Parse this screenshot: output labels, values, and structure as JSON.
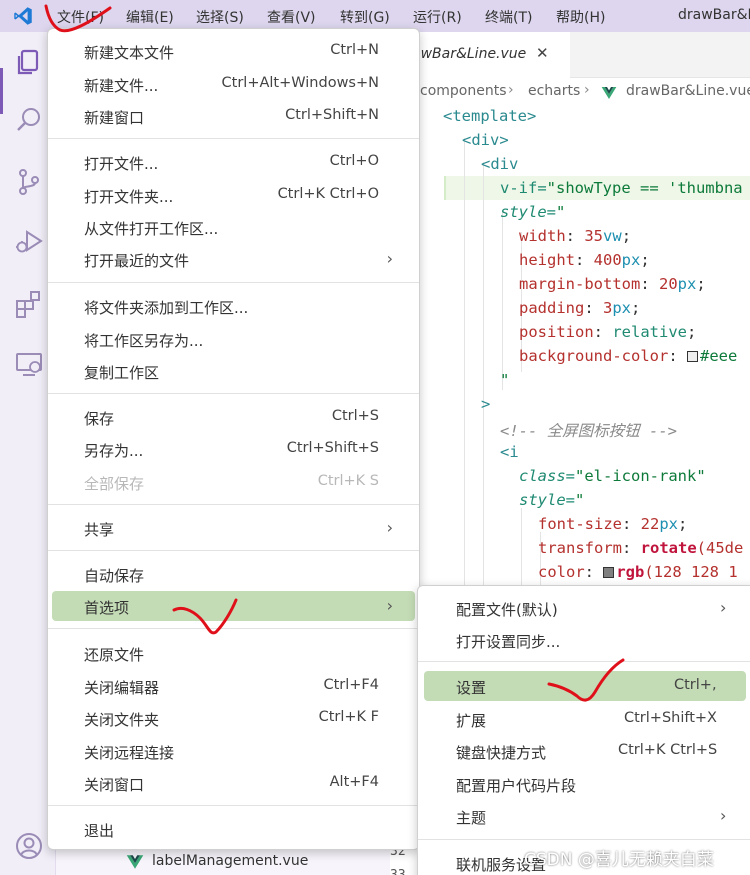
{
  "window": {
    "title": "drawBar&Li"
  },
  "menubar": [
    {
      "label": "文件(F)"
    },
    {
      "label": "编辑(E)"
    },
    {
      "label": "选择(S)"
    },
    {
      "label": "查看(V)"
    },
    {
      "label": "转到(G)"
    },
    {
      "label": "运行(R)"
    },
    {
      "label": "终端(T)"
    },
    {
      "label": "帮助(H)"
    }
  ],
  "activity_bar": {
    "icons": [
      "explorer-icon",
      "search-icon",
      "source-control-icon",
      "run-debug-icon",
      "extensions-icon",
      "remote-explorer-icon",
      "account-icon"
    ]
  },
  "editor": {
    "tab": {
      "label": "awBar&Line.vue",
      "close": "✕"
    },
    "breadcrumb": {
      "part1": "components",
      "sep1": "›",
      "part2": "echarts",
      "sep2": "›",
      "part3": "drawBar&Line.vue"
    },
    "gutter": [
      "32",
      "33"
    ],
    "code": {
      "l1": "<template>",
      "l2": "<div>",
      "l3": "<div",
      "l4_attr": "v-if=",
      "l4_val": "\"showType == 'thumbna",
      "l5_attr": "style=",
      "l5_val": "\"",
      "l6_prop": "width",
      "l6_val": "35",
      "l6_unit": "vw",
      "l7_prop": "height",
      "l7_val": "400",
      "l7_unit": "px",
      "l8_prop": "margin-bottom",
      "l8_val": "20",
      "l8_unit": "px",
      "l9_prop": "padding",
      "l9_val": "3",
      "l9_unit": "px",
      "l10_prop": "position",
      "l10_val": "relative",
      "l11_prop": "background-color",
      "l11_val": "#eee",
      "l12": "\"",
      "l13": ">",
      "l14": "<!-- 全屏图标按钮 -->",
      "l15": "<i",
      "l16_attr": "class=",
      "l16_val": "\"el-icon-rank\"",
      "l17_attr": "style=",
      "l17_val": "\"",
      "l18_prop": "font-size",
      "l18_val": "22",
      "l18_unit": "px",
      "l19_prop": "transform",
      "l19_fn": "rotate",
      "l19_val": "(45de",
      "l20_prop": "color",
      "l20_fn": "rgb",
      "l20_val": "(128 128 1"
    }
  },
  "sidebar": {
    "file_label": "labelManagement.vue"
  },
  "file_menu": {
    "items": [
      {
        "label": "新建文本文件",
        "shortcut": "Ctrl+N"
      },
      {
        "label": "新建文件...",
        "shortcut": "Ctrl+Alt+Windows+N"
      },
      {
        "label": "新建窗口",
        "shortcut": "Ctrl+Shift+N"
      },
      {
        "label": "打开文件...",
        "shortcut": "Ctrl+O"
      },
      {
        "label": "打开文件夹...",
        "shortcut": "Ctrl+K Ctrl+O"
      },
      {
        "label": "从文件打开工作区..."
      },
      {
        "label": "打开最近的文件",
        "submenu": true
      },
      {
        "label": "将文件夹添加到工作区..."
      },
      {
        "label": "将工作区另存为..."
      },
      {
        "label": "复制工作区"
      },
      {
        "label": "保存",
        "shortcut": "Ctrl+S"
      },
      {
        "label": "另存为...",
        "shortcut": "Ctrl+Shift+S"
      },
      {
        "label": "全部保存",
        "shortcut": "Ctrl+K S",
        "disabled": true
      },
      {
        "label": "共享",
        "submenu": true
      },
      {
        "label": "自动保存"
      },
      {
        "label": "首选项",
        "submenu": true,
        "selected": true
      },
      {
        "label": "还原文件"
      },
      {
        "label": "关闭编辑器",
        "shortcut": "Ctrl+F4"
      },
      {
        "label": "关闭文件夹",
        "shortcut": "Ctrl+K F"
      },
      {
        "label": "关闭远程连接"
      },
      {
        "label": "关闭窗口",
        "shortcut": "Alt+F4"
      },
      {
        "label": "退出"
      }
    ],
    "arrow": "›"
  },
  "preferences_menu": {
    "items": [
      {
        "label": "配置文件(默认)",
        "submenu": true
      },
      {
        "label": "打开设置同步..."
      },
      {
        "label": "设置",
        "shortcut": "Ctrl+,",
        "selected": true
      },
      {
        "label": "扩展",
        "shortcut": "Ctrl+Shift+X"
      },
      {
        "label": "键盘快捷方式",
        "shortcut": "Ctrl+K Ctrl+S"
      },
      {
        "label": "配置用户代码片段"
      },
      {
        "label": "主题",
        "submenu": true
      },
      {
        "label": "联机服务设置"
      }
    ]
  },
  "watermark": "CSDN @喜儿无赖夹白菜",
  "colors": {
    "menubar_bg": "#ddd6ee",
    "selection_bg": "#c4dcb6",
    "vscode_blue": "#1f7ad6",
    "annotation_red": "#e0101a"
  }
}
